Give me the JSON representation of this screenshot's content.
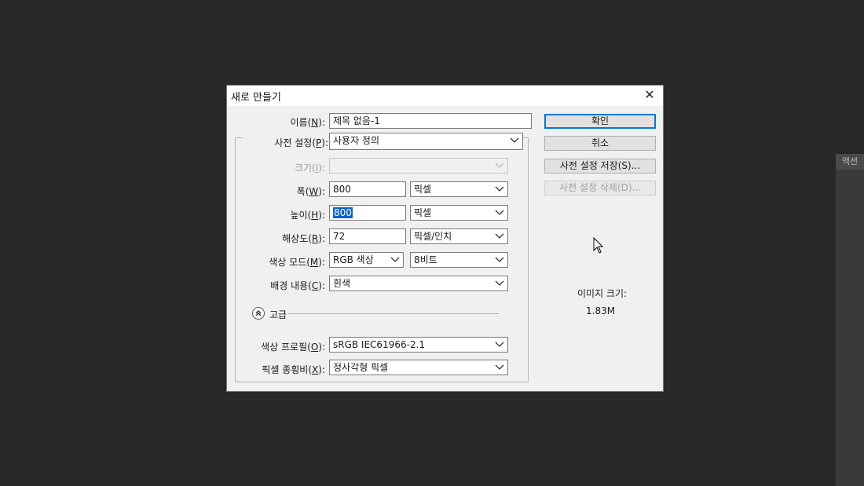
{
  "side_panel": {
    "tab_label": "액션"
  },
  "dialog": {
    "title": "새로 만들기",
    "close_symbol": "✕",
    "name": {
      "label_pre": "이름(",
      "label_key": "N",
      "label_post": "):",
      "value": "제목 없음-1"
    },
    "preset": {
      "label_pre": "사전 설정(",
      "label_key": "P",
      "label_post": "):",
      "value": "사용자 정의"
    },
    "size": {
      "label_pre": "크기(",
      "label_key": "I",
      "label_post": "):",
      "value": ""
    },
    "width": {
      "label_pre": "폭(",
      "label_key": "W",
      "label_post": "):",
      "value": "800",
      "unit": "픽셀"
    },
    "height": {
      "label_pre": "높이(",
      "label_key": "H",
      "label_post": "):",
      "value": "800",
      "unit": "픽셀"
    },
    "resolution": {
      "label_pre": "해상도(",
      "label_key": "R",
      "label_post": "):",
      "value": "72",
      "unit": "픽셀/인치"
    },
    "color_mode": {
      "label_pre": "색상 모드(",
      "label_key": "M",
      "label_post": "):",
      "value": "RGB 색상",
      "depth": "8비트"
    },
    "background": {
      "label_pre": "배경 내용(",
      "label_key": "C",
      "label_post": "):",
      "value": "흰색"
    },
    "advanced": {
      "label": "고급"
    },
    "color_profile": {
      "label_pre": "색상 프로필(",
      "label_key": "O",
      "label_post": "):",
      "value": "sRGB IEC61966-2.1"
    },
    "pixel_aspect": {
      "label_pre": "픽셀 종횡비(",
      "label_key": "X",
      "label_post": "):",
      "value": "정사각형 픽셀"
    },
    "buttons": {
      "ok": "확인",
      "cancel": "취소",
      "save_preset": "사전 설정 저장(S)...",
      "delete_preset": "사전 설정 삭제(D)..."
    },
    "image_size": {
      "label": "이미지 크기:",
      "value": "1.83M"
    }
  },
  "colors": {
    "selection": "#0a64d0",
    "default_button_border": "#0078d7",
    "background": "#282828"
  }
}
